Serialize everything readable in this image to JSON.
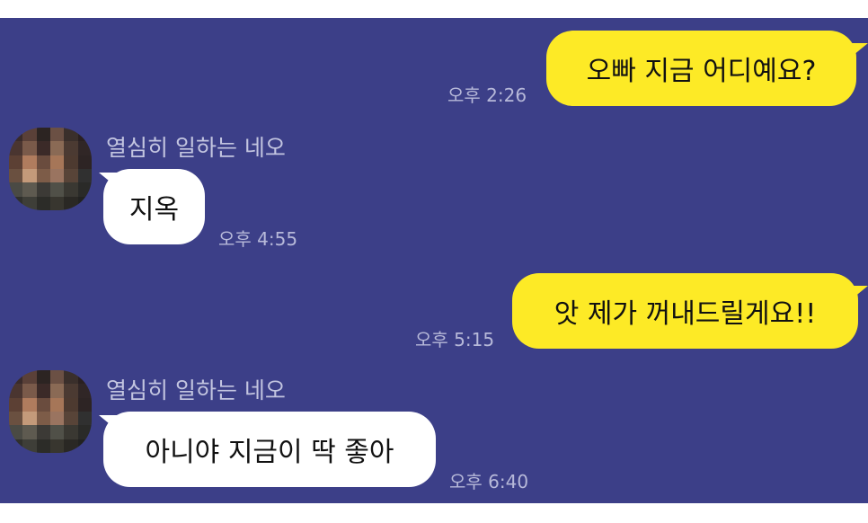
{
  "messages": [
    {
      "direction": "outgoing",
      "text": "오빠 지금 어디예요?",
      "time": "오후 2:26"
    },
    {
      "direction": "incoming",
      "sender": "열심히 일하는 네오",
      "text": "지옥",
      "time": "오후 4:55"
    },
    {
      "direction": "outgoing",
      "text": "앗 제가 꺼내드릴게요!!",
      "time": "오후 5:15"
    },
    {
      "direction": "incoming",
      "sender": "열심히 일하는 네오",
      "text": "아니야 지금이 딱 좋아",
      "time": "오후 6:40"
    }
  ],
  "colors": {
    "background": "#3c3f88",
    "outgoing_bubble": "#fdea26",
    "incoming_bubble": "#ffffff",
    "timestamp": "#b7b9d9"
  },
  "avatar_icon": "pixelated-profile-photo"
}
